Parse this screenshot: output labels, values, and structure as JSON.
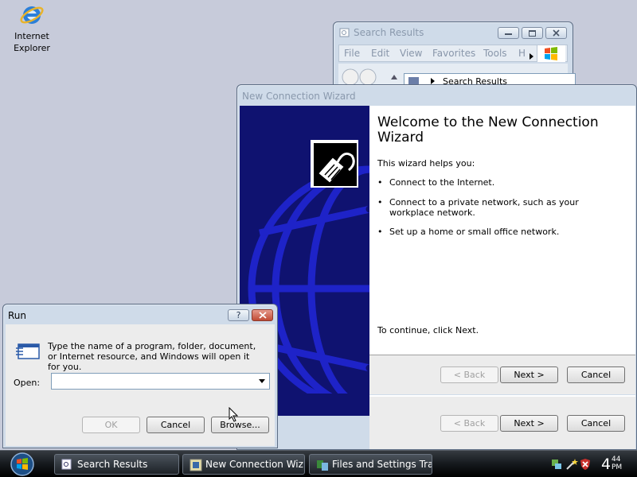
{
  "desktop": {
    "icons": [
      {
        "label": "Internet Explorer",
        "icon": "internet-explorer-icon"
      }
    ]
  },
  "search_window": {
    "title": "Search Results",
    "menu": [
      "File",
      "Edit",
      "View",
      "Favorites",
      "Tools",
      "H"
    ],
    "address": "Search Results"
  },
  "wizard": {
    "title": "New Connection Wizard",
    "heading": "Welcome to the New Connection Wizard",
    "intro": "This wizard helps you:",
    "bullets": [
      "Connect to the Internet.",
      "Connect to a private network, such as your workplace network.",
      "Set up a home or small office network."
    ],
    "continue_text": "To continue, click Next.",
    "back_label": "< Back",
    "next_label": "Next >",
    "cancel_label": "Cancel",
    "back_label_2": "< Back",
    "next_label_2": "Next >",
    "cancel_label_2": "Cancel"
  },
  "run_dialog": {
    "title": "Run",
    "help_label": "?",
    "description": "Type the name of a program, folder, document, or Internet resource, and Windows will open it for you.",
    "open_label": "Open:",
    "open_value": "",
    "ok_label": "OK",
    "cancel_label": "Cancel",
    "browse_label": "Browse..."
  },
  "taskbar": {
    "tasks": [
      {
        "label": "Search Results",
        "icon": "folder-search-icon"
      },
      {
        "label": "New Connection Wiz...",
        "icon": "wizard-icon"
      },
      {
        "label": "Files and Settings Tra...",
        "icon": "transfer-icon"
      }
    ],
    "clock": {
      "hour": "4",
      "minutes": "44",
      "ampm": "PM"
    }
  },
  "colors": {
    "desktop_bg": "#c7cbda",
    "wizard_banner": "#0f1270",
    "close_button": "#c04a34"
  }
}
